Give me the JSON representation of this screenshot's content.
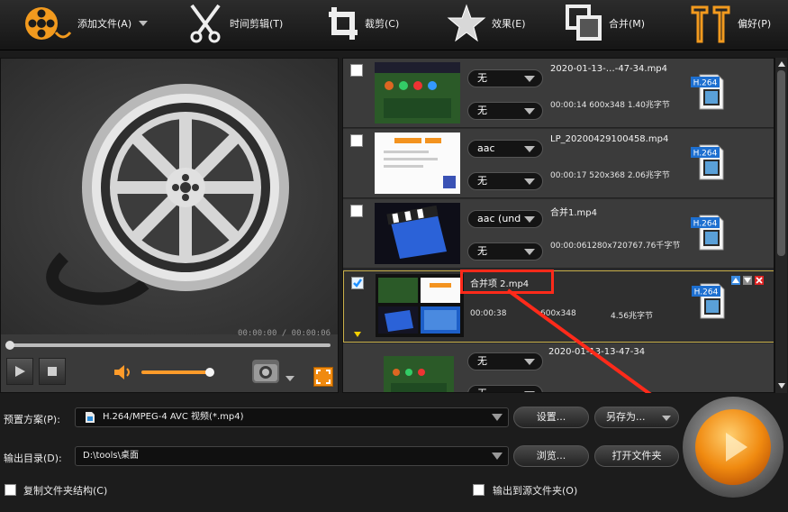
{
  "toolbar": {
    "add_files": "添加文件(A)",
    "trim": "时间剪辑(T)",
    "crop": "裁剪(C)",
    "effects": "效果(E)",
    "merge": "合并(M)",
    "preferences": "偏好(P)"
  },
  "player": {
    "time": "00:00:00 / 00:00:06",
    "seek_fraction": 0.0,
    "volume_fraction": 1.0
  },
  "files": [
    {
      "name": "2020-01-13-…-47-34.mp4",
      "info": "00:00:14 600x348  1.40兆字节",
      "audio": "无",
      "subtitle": "无",
      "format": "H.264",
      "checked": false
    },
    {
      "name": "LP_20200429100458.mp4",
      "info": "00:00:17 520x368  2.06兆字节",
      "audio": "aac",
      "subtitle": "无",
      "format": "H.264",
      "checked": false
    },
    {
      "name": "合并1.mp4",
      "info": "00:00:061280x720767.76千字节",
      "audio": "aac (und",
      "subtitle": "无",
      "format": "H.264",
      "checked": false
    },
    {
      "name": "合并项 2.mp4",
      "duration": "00:00:38",
      "resolution": "600x348",
      "size": "4.56兆字节",
      "format": "H.264",
      "checked": true
    },
    {
      "name": "2020-01-13-13-47-34",
      "audio": "无",
      "subtitle": "无",
      "checked": false
    }
  ],
  "bottom": {
    "preset_label": "预置方案(P):",
    "preset_value": "H.264/MPEG-4 AVC 视频(*.mp4)",
    "settings_button": "设置...",
    "save_as_button": "另存为...",
    "output_label": "输出目录(D):",
    "output_value": "D:\\tools\\桌面",
    "browse_button": "浏览...",
    "open_folder_button": "打开文件夹",
    "copy_structure": "复制文件夹结构(C)",
    "output_to_source": "输出到源文件夹(O)"
  },
  "colors": {
    "accent": "#f08a10",
    "highlight_box": "#ff2a1a",
    "selected_border": "#c9b04a"
  }
}
